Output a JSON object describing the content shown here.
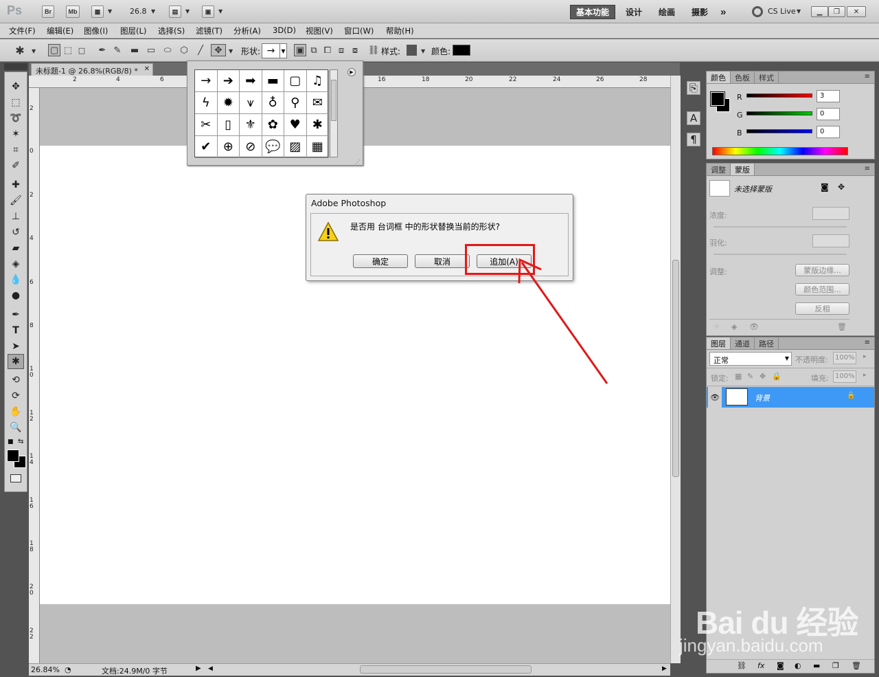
{
  "app": {
    "logo": "Ps",
    "bridge": "Br",
    "minibridge": "Mb",
    "zoom": "26.8",
    "workspaces": [
      "基本功能",
      "设计",
      "绘画",
      "摄影"
    ],
    "more": "»",
    "cs_live": "CS Live"
  },
  "menu": [
    "文件(F)",
    "编辑(E)",
    "图像(I)",
    "图层(L)",
    "选择(S)",
    "滤镜(T)",
    "分析(A)",
    "3D(D)",
    "视图(V)",
    "窗口(W)",
    "帮助(H)"
  ],
  "options": {
    "shape_label": "形状:",
    "shape_value": "→",
    "style_label": "样式:",
    "color_label": "颜色:",
    "color_value": "#000000"
  },
  "document": {
    "tab_title": "未标题-1 @ 26.8%(RGB/8) *",
    "ruler_top": [
      "2",
      "4",
      "6",
      "16",
      "18",
      "20",
      "22",
      "24",
      "26",
      "28"
    ],
    "ruler_left": [
      "2",
      "0",
      "2",
      "4",
      "6",
      "8",
      "10",
      "12",
      "14",
      "16",
      "18",
      "20",
      "22"
    ],
    "status_zoom": "26.84%",
    "status_doc": "文档:24.9M/0 字节"
  },
  "shape_popup": {
    "shapes": [
      "arrow-thin",
      "arrow-medium",
      "arrow-bold",
      "banner",
      "frame",
      "music-note",
      "lightning",
      "starburst",
      "grass",
      "lightbulb",
      "pushpin",
      "envelope",
      "scissors",
      "blank-page",
      "fleur-de-lis",
      "puzzle",
      "heart",
      "blot",
      "checkmark",
      "target",
      "no-sign",
      "speech-bubble",
      "hatch",
      "checker"
    ],
    "glyphs": [
      "→",
      "➔",
      "➡",
      "▬",
      "▢",
      "♫",
      "ϟ",
      "✹",
      "⩛",
      "♁",
      "⚲",
      "✉",
      "✂",
      "▯",
      "⚜",
      "✿",
      "♥",
      "✱",
      "✔",
      "⊕",
      "⊘",
      "💬",
      "▨",
      "▦"
    ]
  },
  "dialog": {
    "title": "Adobe Photoshop",
    "message": "是否用 台词框 中的形状替换当前的形状?",
    "ok": "确定",
    "cancel": "取消",
    "append": "追加(A)"
  },
  "color_panel": {
    "tabs": [
      "颜色",
      "色板",
      "样式"
    ],
    "r_label": "R",
    "g_label": "G",
    "b_label": "B",
    "r": "3",
    "g": "0",
    "b": "0"
  },
  "masks_panel": {
    "tabs": [
      "调整",
      "蒙版"
    ],
    "no_mask": "未选择蒙版",
    "density": "浓度:",
    "feather": "羽化:",
    "refine": "调整:",
    "mask_edge": "蒙版边缘...",
    "color_range": "颜色范围...",
    "invert": "反相"
  },
  "layers_panel": {
    "tabs": [
      "图层",
      "通道",
      "路径"
    ],
    "blend_mode": "正常",
    "opacity_label": "不透明度:",
    "opacity": "100%",
    "lock_label": "锁定:",
    "fill_label": "填充:",
    "fill": "100%",
    "layer_name": "背景"
  },
  "colors": {
    "highlight": "#e21818",
    "layer_selected": "#3d99f5"
  },
  "watermark": {
    "brand": "Bai du 经验",
    "url": "jingyan.baidu.com"
  }
}
